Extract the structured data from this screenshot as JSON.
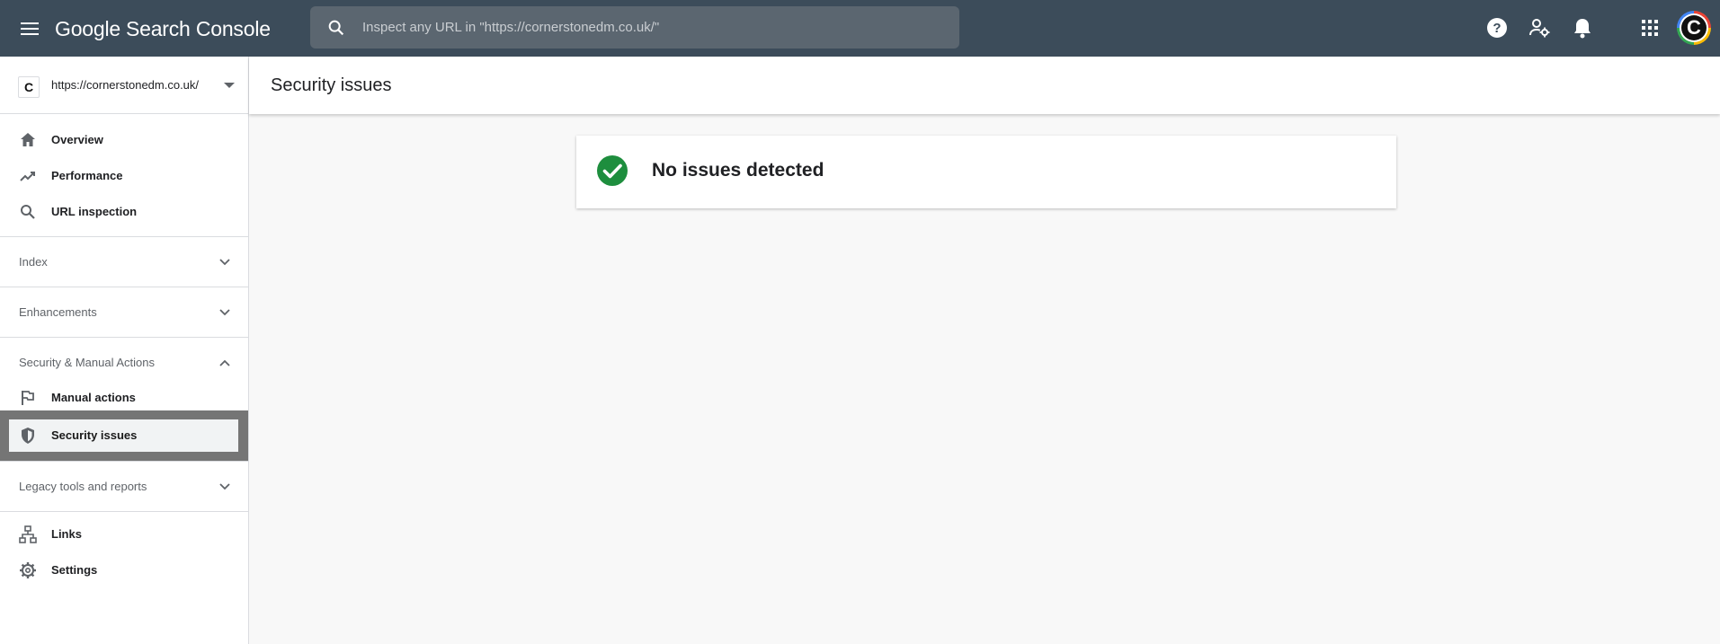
{
  "app": {
    "logo_google": "Google",
    "logo_product": "Search Console"
  },
  "search": {
    "placeholder": "Inspect any URL in \"https://cornerstonedm.co.uk/\""
  },
  "property": {
    "favicon_letter": "C",
    "url": "https://cornerstonedm.co.uk/"
  },
  "nav": {
    "overview": "Overview",
    "performance": "Performance",
    "url_inspection": "URL inspection",
    "index": "Index",
    "enhancements": "Enhancements",
    "security_section": "Security & Manual Actions",
    "manual_actions": "Manual actions",
    "security_issues": "Security issues",
    "legacy": "Legacy tools and reports",
    "links": "Links",
    "settings": "Settings"
  },
  "page": {
    "title": "Security issues",
    "status_message": "No issues detected"
  },
  "avatar_letter": "C",
  "colors": {
    "topbar": "#3c4c5a",
    "success": "#1e8e3e",
    "active_highlight": "#757575"
  }
}
